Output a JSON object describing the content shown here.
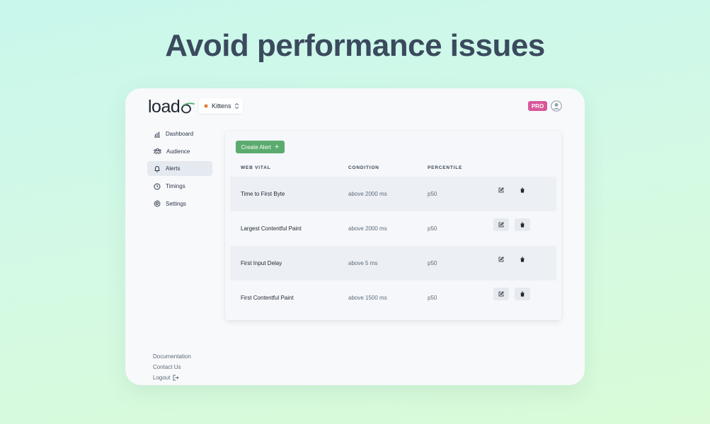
{
  "headline": "Avoid performance issues",
  "header": {
    "logo_text": "load",
    "project": "Kittens",
    "plan_badge": "PRO"
  },
  "sidebar": {
    "items": [
      {
        "label": "Dashboard",
        "icon": "bar-chart-icon"
      },
      {
        "label": "Audience",
        "icon": "users-icon"
      },
      {
        "label": "Alerts",
        "icon": "bell-icon",
        "active": true
      },
      {
        "label": "Timings",
        "icon": "clock-icon"
      },
      {
        "label": "Settings",
        "icon": "gear-icon"
      }
    ],
    "footer": {
      "documentation": "Documentation",
      "contact": "Contact Us",
      "logout": "Logout"
    }
  },
  "alerts": {
    "create_label": "Create Alert",
    "columns": [
      "WEB VITAL",
      "CONDITION",
      "PERCENTILE"
    ],
    "rows": [
      {
        "vital": "Time to First Byte",
        "condition": "above 2000 ms",
        "percentile": "p50"
      },
      {
        "vital": "Largest Contentful Paint",
        "condition": "above 2000 ms",
        "percentile": "p50"
      },
      {
        "vital": "First Input Delay",
        "condition": "above 5 ms",
        "percentile": "p50"
      },
      {
        "vital": "First Contentful Paint",
        "condition": "above 1500 ms",
        "percentile": "p50"
      }
    ]
  },
  "colors": {
    "accent_green": "#5bab6f",
    "pro_pink": "#d9569a",
    "headline": "#3b4a5e"
  }
}
